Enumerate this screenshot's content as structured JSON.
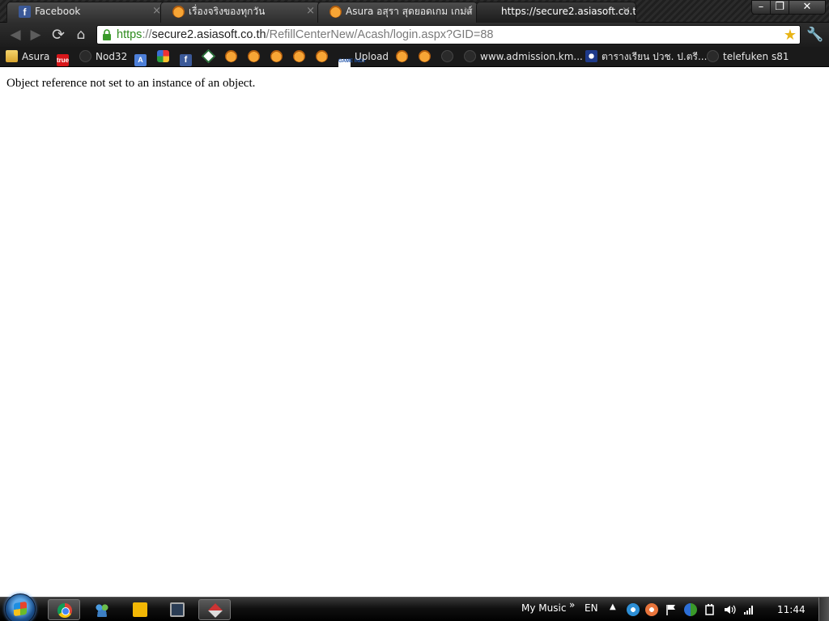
{
  "tabs": [
    {
      "label": "Facebook",
      "icon": "facebook-icon"
    },
    {
      "label": "เรื่องจริงของทุกวัน",
      "icon": "asura-cat-icon"
    },
    {
      "label": "Asura อสุรา สุดยอดเกม เกมส์",
      "icon": "asura-cat-icon"
    },
    {
      "label": "https://secure2.asiasoft.co.t",
      "icon": "none",
      "active": true
    }
  ],
  "window_controls": {
    "minimize": "–",
    "maximize": "❐",
    "close": "✕"
  },
  "toolbar": {
    "back": "◀",
    "forward": "▶",
    "reload": "⟳",
    "home": "⌂",
    "star": "★",
    "wrench": "🔧",
    "url": {
      "scheme": "https",
      "separator": "://",
      "host": "secure2.asiasoft.co.th",
      "path": "/RefillCenterNew/Acash/login.aspx?GID=88"
    }
  },
  "bookmarks": [
    {
      "label": "Asura",
      "icon": "folder-icon"
    },
    {
      "label": "",
      "icon": "true-icon",
      "icon_text": "true"
    },
    {
      "label": "Nod32",
      "icon": "dark-circle-icon"
    },
    {
      "label": "",
      "icon": "translate-icon"
    },
    {
      "label": "",
      "icon": "google-icon"
    },
    {
      "label": "",
      "icon": "facebook-icon"
    },
    {
      "label": "",
      "icon": "diamond-icon"
    },
    {
      "label": "",
      "icon": "asura-cat-icon"
    },
    {
      "label": "",
      "icon": "asura-cat-icon"
    },
    {
      "label": "",
      "icon": "asura-cat-icon"
    },
    {
      "label": "",
      "icon": "asura-cat-icon"
    },
    {
      "label": "",
      "icon": "asura-cat-icon"
    },
    {
      "label": "Upload",
      "icon": "game-indy-icon",
      "icon_text": "GAME INDY"
    },
    {
      "label": "",
      "icon": "asura-cat-icon"
    },
    {
      "label": "",
      "icon": "asura-cat-icon"
    },
    {
      "label": "",
      "icon": "dark-circle-icon"
    },
    {
      "label": "www.admission.km...",
      "icon": "dark-circle-icon"
    },
    {
      "label": "ตารางเรียน ปวช. ป.ตรี...",
      "icon": "seal-icon"
    },
    {
      "label": "telefuken s81",
      "icon": "dark-circle-icon"
    }
  ],
  "page": {
    "error_message": "Object reference not set to an instance of an object."
  },
  "taskbar": {
    "my_music": "My Music",
    "expand": "»",
    "language": "EN",
    "tray_up": "▲",
    "clock": "11:44"
  },
  "colors": {
    "url_scheme": "#2e8b1d",
    "url_path": "#7a7a7a",
    "facebook_blue": "#3b5998"
  }
}
